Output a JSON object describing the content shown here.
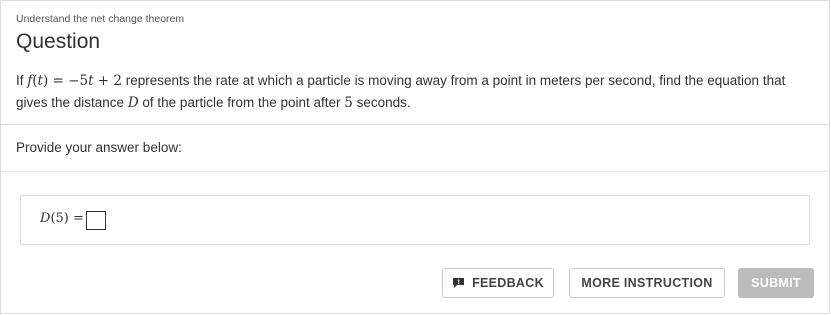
{
  "header": {
    "topic": "Understand the net change theorem",
    "title": "Question"
  },
  "question": {
    "t1": "If ",
    "m1": "f",
    "m2": "(",
    "m3": "t",
    "m4": ")",
    "m5": " = −5",
    "m6": "t",
    "m7": " + 2",
    "t2": " represents the rate at which a particle is moving away from a point in meters per second, find the equation that  gives the distance ",
    "m8": "D",
    "t3": " of the particle from the point after ",
    "m9": "5",
    "t4": " seconds."
  },
  "answer": {
    "prompt": "Provide your answer below:",
    "label_d": "D",
    "label_rest": "(5) =",
    "input_value": ""
  },
  "buttons": {
    "feedback": "FEEDBACK",
    "more_instruction": "MORE INSTRUCTION",
    "submit": "SUBMIT"
  },
  "colors": {
    "submit_bg": "#bbbbbb",
    "border": "#dcdcdc",
    "text": "#333333"
  },
  "icons": {
    "feedback": "feedback-icon"
  }
}
